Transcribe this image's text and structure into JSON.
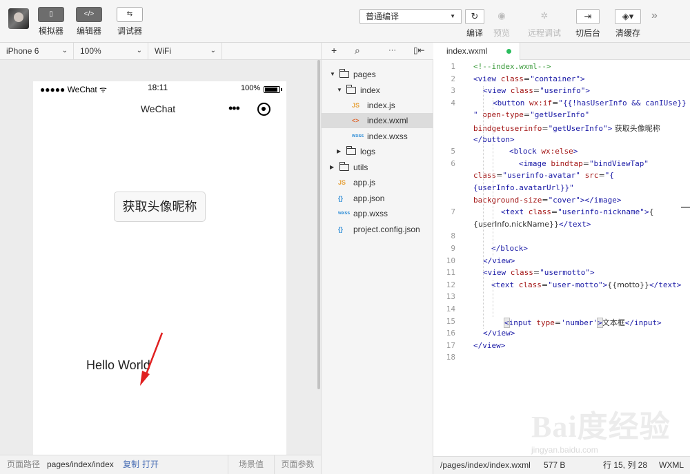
{
  "toolbar": {
    "simulator": {
      "icon": "phone-icon",
      "glyph": "▯",
      "label": "模拟器"
    },
    "editor": {
      "icon": "code-icon",
      "glyph": "</>",
      "label": "编辑器"
    },
    "debugger": {
      "icon": "debug-icon",
      "glyph": "⇆",
      "label": "调试器"
    },
    "compile_mode": "普通编译",
    "compile": {
      "icon": "refresh-icon",
      "glyph": "↻",
      "label": "编译"
    },
    "preview": {
      "icon": "eye-icon",
      "glyph": "◉",
      "label": "预览"
    },
    "remote_debug": {
      "icon": "bug-icon",
      "glyph": "✲",
      "label": "远程调试"
    },
    "background": {
      "icon": "switch-background-icon",
      "glyph": "⇥",
      "label": "切后台"
    },
    "clear_cache": {
      "icon": "layers-icon",
      "glyph": "◈▾",
      "label": "清缓存"
    },
    "more_glyph": "»"
  },
  "sim_toolbar": {
    "device": "iPhone 6",
    "zoom": "100%",
    "network": "WiFi"
  },
  "phone": {
    "signal": "●●●●● WeChat ᯤ",
    "time": "18:11",
    "battery": "100%",
    "nav_title": "WeChat",
    "menu_dots": "•••",
    "auth_button": "获取头像昵称",
    "motto": "Hello World"
  },
  "sim_status": {
    "label": "页面路径",
    "path": "pages/index/index",
    "copy": "复制",
    "open": "打开",
    "scene": "场景值",
    "params": "页面参数"
  },
  "tree_toolbar": {
    "add": "+",
    "search": "⌕",
    "more": "···",
    "collapse": "▯⇤"
  },
  "file_tree": [
    {
      "kind": "folder",
      "name": "pages",
      "depth": 0,
      "open": true
    },
    {
      "kind": "folder",
      "name": "index",
      "depth": 1,
      "open": true
    },
    {
      "kind": "file",
      "type": "js",
      "badge": "JS",
      "name": "index.js",
      "depth": 2
    },
    {
      "kind": "file",
      "type": "wxml",
      "badge": "<>",
      "name": "index.wxml",
      "depth": 2,
      "selected": true
    },
    {
      "kind": "file",
      "type": "wxss",
      "badge": "wxss",
      "name": "index.wxss",
      "depth": 2
    },
    {
      "kind": "folder",
      "name": "logs",
      "depth": 1,
      "open": false
    },
    {
      "kind": "folder",
      "name": "utils",
      "depth": 0,
      "open": false
    },
    {
      "kind": "file",
      "type": "js",
      "badge": "JS",
      "name": "app.js",
      "depth": 0
    },
    {
      "kind": "file",
      "type": "json",
      "badge": "{}",
      "name": "app.json",
      "depth": 0
    },
    {
      "kind": "file",
      "type": "wxss",
      "badge": "wxss",
      "name": "app.wxss",
      "depth": 0
    },
    {
      "kind": "file",
      "type": "json",
      "badge": "{}",
      "name": "project.config.json",
      "depth": 0
    }
  ],
  "editor": {
    "tab": "index.wxml",
    "line_numbers": [
      "1",
      "2",
      "3",
      "4",
      "5",
      "6",
      "7",
      "8",
      "9",
      "10",
      "11",
      "12",
      "13",
      "14",
      "15",
      "16",
      "17",
      "18"
    ],
    "lines": [
      [
        {
          "c": "cmt",
          "t": "<!--index.wxml-->"
        }
      ],
      [
        {
          "c": "tg",
          "t": "<view "
        },
        {
          "c": "at",
          "t": "class"
        },
        {
          "c": "tx",
          "t": "="
        },
        {
          "c": "st",
          "t": "\"container\""
        },
        {
          "c": "tg",
          "t": ">"
        }
      ],
      [
        {
          "c": "tg",
          "t": "<view "
        },
        {
          "c": "at",
          "t": "class"
        },
        {
          "c": "tx",
          "t": "="
        },
        {
          "c": "st",
          "t": "\"userinfo\""
        },
        {
          "c": "tg",
          "t": ">"
        }
      ],
      [
        {
          "c": "tg",
          "t": "<button "
        },
        {
          "c": "at",
          "t": "wx:if"
        },
        {
          "c": "tx",
          "t": "="
        },
        {
          "c": "st",
          "t": "\"{{!hasUserInfo && canIUse}}"
        }
      ],
      [
        {
          "c": "st",
          "t": "\" "
        },
        {
          "c": "at",
          "t": "open-type"
        },
        {
          "c": "tx",
          "t": "="
        },
        {
          "c": "st",
          "t": "\"getUserInfo\""
        }
      ],
      [
        {
          "c": "at",
          "t": "bindgetuserinfo"
        },
        {
          "c": "tx",
          "t": "="
        },
        {
          "c": "st",
          "t": "\"getUserInfo\""
        },
        {
          "c": "tg",
          "t": ">"
        },
        {
          "c": "tx",
          "t": " 获取头像昵称"
        }
      ],
      [
        {
          "c": "tg",
          "t": "</button>"
        }
      ],
      [
        {
          "c": "tg",
          "t": "<block "
        },
        {
          "c": "at",
          "t": "wx:else"
        },
        {
          "c": "tg",
          "t": ">"
        }
      ],
      [
        {
          "c": "tg",
          "t": "<image "
        },
        {
          "c": "at",
          "t": "bindtap"
        },
        {
          "c": "tx",
          "t": "="
        },
        {
          "c": "st",
          "t": "\"bindViewTap\""
        }
      ],
      [
        {
          "c": "at",
          "t": "class"
        },
        {
          "c": "tx",
          "t": "="
        },
        {
          "c": "st",
          "t": "\"userinfo-avatar\" "
        },
        {
          "c": "at",
          "t": "src"
        },
        {
          "c": "tx",
          "t": "="
        },
        {
          "c": "st",
          "t": "\"{"
        }
      ],
      [
        {
          "c": "st",
          "t": "{userInfo.avatarUrl}}\""
        }
      ],
      [
        {
          "c": "at",
          "t": "background-size"
        },
        {
          "c": "tx",
          "t": "="
        },
        {
          "c": "st",
          "t": "\"cover\""
        },
        {
          "c": "tg",
          "t": "></image>"
        }
      ],
      [
        {
          "c": "tg",
          "t": "<text "
        },
        {
          "c": "at",
          "t": "class"
        },
        {
          "c": "tx",
          "t": "="
        },
        {
          "c": "st",
          "t": "\"userinfo-nickname\""
        },
        {
          "c": "tg",
          "t": ">"
        },
        {
          "c": "tx",
          "t": "{"
        }
      ],
      [
        {
          "c": "tx",
          "t": "{userInfo.nickName}}"
        },
        {
          "c": "tg",
          "t": "</text>"
        }
      ],
      [],
      [
        {
          "c": "tg",
          "t": "</block>"
        }
      ],
      [
        {
          "c": "tg",
          "t": "</view>"
        }
      ],
      [
        {
          "c": "tg",
          "t": "<view "
        },
        {
          "c": "at",
          "t": "class"
        },
        {
          "c": "tx",
          "t": "="
        },
        {
          "c": "st",
          "t": "\"usermotto\""
        },
        {
          "c": "tg",
          "t": ">"
        }
      ],
      [
        {
          "c": "tg",
          "t": "<text "
        },
        {
          "c": "at",
          "t": "class"
        },
        {
          "c": "tx",
          "t": "="
        },
        {
          "c": "st",
          "t": "\"user-motto\""
        },
        {
          "c": "tg",
          "t": ">"
        },
        {
          "c": "tx",
          "t": "{{motto}}"
        },
        {
          "c": "tg",
          "t": "</text>"
        }
      ],
      [],
      [],
      [
        {
          "c": "tg hl",
          "t": "<"
        },
        {
          "c": "tg",
          "t": "input "
        },
        {
          "c": "at",
          "t": "type"
        },
        {
          "c": "tx",
          "t": "="
        },
        {
          "c": "st",
          "t": "'number'"
        },
        {
          "c": "tg hl",
          "t": ">"
        },
        {
          "c": "tx",
          "t": "文本框"
        },
        {
          "c": "tg",
          "t": "</input>"
        }
      ],
      [
        {
          "c": "tg",
          "t": "</view>"
        }
      ],
      [
        {
          "c": "tg",
          "t": "</view>"
        }
      ],
      []
    ]
  },
  "editor_status": {
    "path": "/pages/index/index.wxml",
    "size": "577 B",
    "position": "行 15, 列 28",
    "lang": "WXML"
  },
  "watermark": {
    "text": "Bai度经验",
    "sub": "jingyan.baidu.com"
  }
}
